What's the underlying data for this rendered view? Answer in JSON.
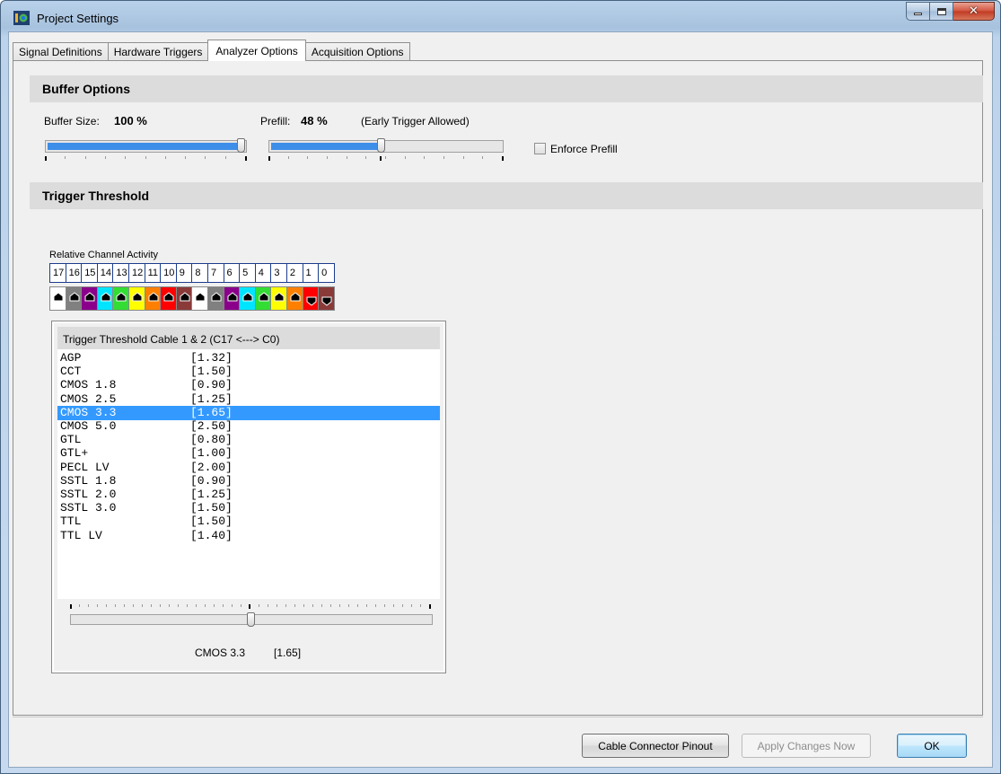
{
  "window": {
    "title": "Project Settings"
  },
  "tabs": [
    {
      "label": "Signal Definitions"
    },
    {
      "label": "Hardware Triggers"
    },
    {
      "label": "Analyzer Options"
    },
    {
      "label": "Acquisition Options"
    }
  ],
  "buffer": {
    "section_title": "Buffer Options",
    "size_label": "Buffer Size:",
    "size_value": "100 %",
    "size_percent": 100,
    "prefill_label": "Prefill:",
    "prefill_value": "48 %",
    "prefill_percent": 48,
    "prefill_note": "(Early Trigger Allowed)",
    "enforce_prefill_label": "Enforce Prefill",
    "enforce_prefill_checked": false
  },
  "trigger": {
    "section_title": "Trigger Threshold",
    "activity_label": "Relative Channel Activity",
    "channels": [
      {
        "num": "17",
        "color": "#ffffff",
        "dir": "up"
      },
      {
        "num": "16",
        "color": "#808080",
        "dir": "up"
      },
      {
        "num": "15",
        "color": "#8b008b",
        "dir": "up"
      },
      {
        "num": "14",
        "color": "#00e5ff",
        "dir": "up"
      },
      {
        "num": "13",
        "color": "#33dd33",
        "dir": "up"
      },
      {
        "num": "12",
        "color": "#ffff00",
        "dir": "up"
      },
      {
        "num": "11",
        "color": "#ff8000",
        "dir": "up"
      },
      {
        "num": "10",
        "color": "#ff0000",
        "dir": "up"
      },
      {
        "num": "9",
        "color": "#8b3a3a",
        "dir": "up"
      },
      {
        "num": "8",
        "color": "#ffffff",
        "dir": "up"
      },
      {
        "num": "7",
        "color": "#808080",
        "dir": "up"
      },
      {
        "num": "6",
        "color": "#8b008b",
        "dir": "up"
      },
      {
        "num": "5",
        "color": "#00e5ff",
        "dir": "up"
      },
      {
        "num": "4",
        "color": "#33dd33",
        "dir": "up"
      },
      {
        "num": "3",
        "color": "#ffff00",
        "dir": "up"
      },
      {
        "num": "2",
        "color": "#ff8000",
        "dir": "up"
      },
      {
        "num": "1",
        "color": "#ff0000",
        "dir": "down"
      },
      {
        "num": "0",
        "color": "#8b3a3a",
        "dir": "down"
      }
    ],
    "panel_header": "Trigger Threshold   Cable 1 & 2  (C17 <---> C0)",
    "list": [
      {
        "name": "AGP",
        "value": "[1.32]"
      },
      {
        "name": "CCT",
        "value": "[1.50]"
      },
      {
        "name": "CMOS 1.8",
        "value": "[0.90]"
      },
      {
        "name": "CMOS 2.5",
        "value": "[1.25]"
      },
      {
        "name": "CMOS 3.3",
        "value": "[1.65]",
        "selected": true
      },
      {
        "name": "CMOS 5.0",
        "value": "[2.50]"
      },
      {
        "name": "GTL",
        "value": "[0.80]"
      },
      {
        "name": "GTL+",
        "value": "[1.00]"
      },
      {
        "name": "PECL LV",
        "value": "[2.00]"
      },
      {
        "name": "SSTL 1.8",
        "value": "[0.90]"
      },
      {
        "name": "SSTL 2.0",
        "value": "[1.25]"
      },
      {
        "name": "SSTL 3.0",
        "value": "[1.50]"
      },
      {
        "name": "TTL",
        "value": "[1.50]"
      },
      {
        "name": "TTL LV",
        "value": "[1.40]"
      }
    ],
    "slider_percent": 50,
    "selected_name": "CMOS 3.3",
    "selected_value": "[1.65]"
  },
  "footer": {
    "pinout_button": "Cable Connector Pinout",
    "apply_button": "Apply Changes Now",
    "ok_button": "OK"
  }
}
